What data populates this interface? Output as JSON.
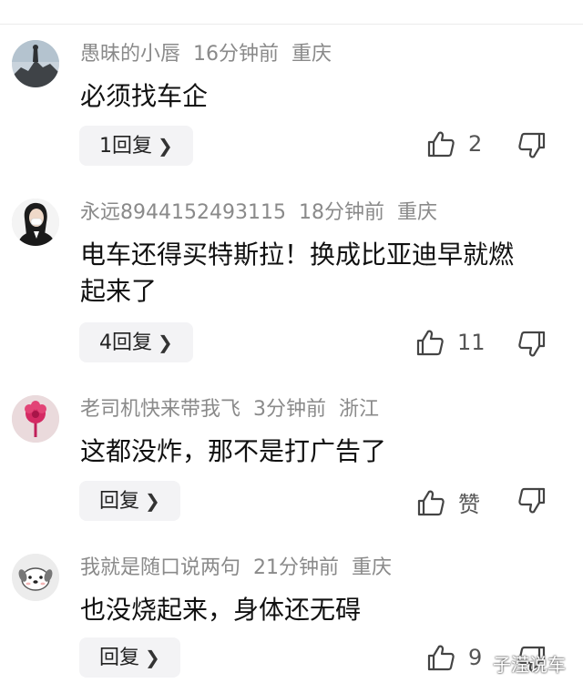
{
  "comments": [
    {
      "username": "愚昧的小唇",
      "time": "16分钟前",
      "location": "重庆",
      "text": "必须找车企",
      "reply_label": "1回复",
      "like_label": "2",
      "avatar_icon": "mountain-landscape-avatar"
    },
    {
      "username": "永远8944152493115",
      "time": "18分钟前",
      "location": "重庆",
      "text": "电车还得买特斯拉！换成比亚迪早就燃起来了",
      "reply_label": "4回复",
      "like_label": "11",
      "avatar_icon": "woman-portrait-avatar"
    },
    {
      "username": "老司机快来带我飞",
      "time": "3分钟前",
      "location": "浙江",
      "text": "这都没炸，那不是打广告了",
      "reply_label": "回复",
      "like_label": "赞",
      "avatar_icon": "red-flower-avatar"
    },
    {
      "username": "我就是随口说两句",
      "time": "21分钟前",
      "location": "重庆",
      "text": "也没烧起来，身体还无碍",
      "reply_label": "回复",
      "like_label": "9",
      "avatar_icon": "dog-face-avatar"
    }
  ],
  "watermark": "子滢说车",
  "icons": {
    "like": "thumbs-up-icon",
    "dislike": "thumbs-down-icon",
    "chevron": "chevron-right-icon"
  }
}
